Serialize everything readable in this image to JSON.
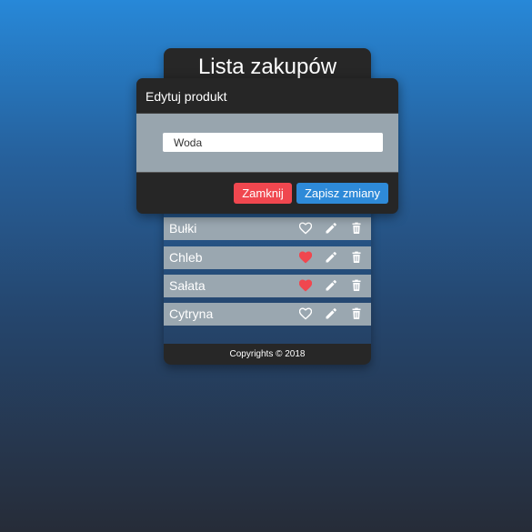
{
  "app": {
    "title": "Lista zakupów",
    "footer": "Copyrights © 2018",
    "items": [
      {
        "name": "Bułki",
        "favorite": false
      },
      {
        "name": "Chleb",
        "favorite": true
      },
      {
        "name": "Sałata",
        "favorite": true
      },
      {
        "name": "Cytryna",
        "favorite": false
      }
    ]
  },
  "modal": {
    "title": "Edytuj produkt",
    "input_value": "Woda",
    "close_label": "Zamknij",
    "save_label": "Zapisz zmiany"
  },
  "icons": {
    "favorite": "heart-icon",
    "edit": "pencil-icon",
    "delete": "trash-icon"
  },
  "colors": {
    "favorite_active": "#f0474f",
    "close_button": "#f0474f",
    "save_button": "#2e8ad8"
  }
}
